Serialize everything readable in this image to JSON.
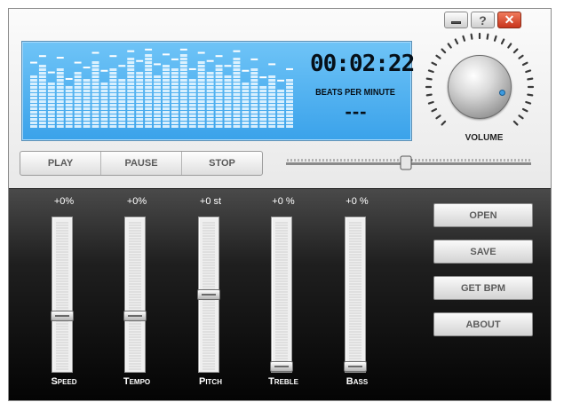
{
  "window_controls": {
    "help_glyph": "?",
    "close_glyph": "✕"
  },
  "display": {
    "time": "00:02:22",
    "bpm_label": "BEATS PER MINUTE",
    "bpm_value": "---",
    "spectrum_levels": [
      0.65,
      0.78,
      0.55,
      0.72,
      0.5,
      0.68,
      0.6,
      0.82,
      0.58,
      0.76,
      0.62,
      0.85,
      0.7,
      0.9,
      0.66,
      0.8,
      0.74,
      0.92,
      0.6,
      0.84,
      0.7,
      0.78,
      0.64,
      0.86,
      0.58,
      0.72,
      0.52,
      0.66,
      0.48,
      0.6
    ],
    "spectrum_peaks": [
      0.82,
      0.9,
      0.7,
      0.88,
      0.62,
      0.82,
      0.76,
      0.94,
      0.72,
      0.9,
      0.78,
      0.96,
      0.84,
      0.98,
      0.8,
      0.92,
      0.86,
      0.98,
      0.74,
      0.94,
      0.84,
      0.9,
      0.78,
      0.96,
      0.72,
      0.86,
      0.64,
      0.8,
      0.6,
      0.74
    ]
  },
  "volume": {
    "label": "VOLUME"
  },
  "transport": {
    "play": "PLAY",
    "pause": "PAUSE",
    "stop": "STOP"
  },
  "seek": {
    "position": 0.49
  },
  "sliders": [
    {
      "label": "Speed",
      "value": "+0%",
      "level": 0.35
    },
    {
      "label": "Tempo",
      "value": "+0%",
      "level": 0.35
    },
    {
      "label": "Pitch",
      "value": "+0 st",
      "level": 0.5
    },
    {
      "label": "Treble",
      "value": "+0 %",
      "level": 0.0
    },
    {
      "label": "Bass",
      "value": "+0 %",
      "level": 0.0
    }
  ],
  "side_buttons": {
    "open": "OPEN",
    "save": "SAVE",
    "get_bpm": "GET BPM",
    "about": "ABOUT"
  }
}
